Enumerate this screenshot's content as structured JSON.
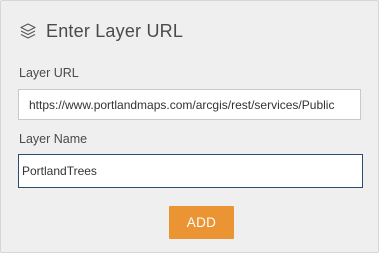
{
  "header": {
    "icon": "layers-icon",
    "title": "Enter Layer URL"
  },
  "layer_url": {
    "label": "Layer URL",
    "value": "https://www.portlandmaps.com/arcgis/rest/services/Public"
  },
  "layer_name": {
    "label": "Layer Name",
    "value": "PortlandTrees"
  },
  "actions": {
    "add_label": "ADD"
  },
  "colors": {
    "accent": "#eb9433",
    "focus_border": "#2b4d6d",
    "panel_bg": "#efefef"
  }
}
